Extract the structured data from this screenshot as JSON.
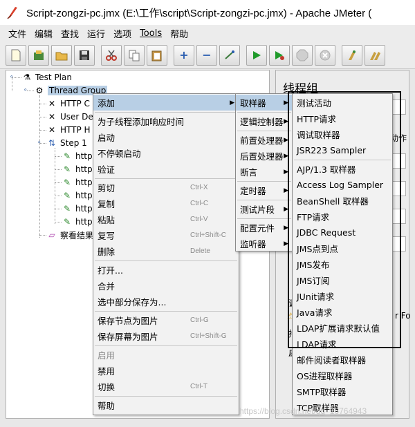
{
  "window": {
    "title": "Script-zongzi-pc.jmx (E:\\工作\\script\\Script-zongzi-pc.jmx) - Apache JMeter ("
  },
  "menubar": [
    "文件",
    "编辑",
    "查找",
    "运行",
    "选项",
    "Tools",
    "帮助"
  ],
  "toolbar": {
    "buttons": [
      "new-icon",
      "templates-icon",
      "open-icon",
      "save-icon",
      "cut-icon",
      "copy-icon",
      "paste-icon",
      "expand-icon",
      "collapse-icon",
      "toggle-icon",
      "start-icon",
      "start-no-pause-icon",
      "stop-icon",
      "shutdown-icon",
      "clear-icon",
      "clear-all-icon"
    ]
  },
  "tree": {
    "test_plan": "Test Plan",
    "thread_group": "Thread Group",
    "http_c": "HTTP C",
    "user_de": "User De",
    "http_h": "HTTP H",
    "step1": "Step 1",
    "http_children": [
      "http:",
      "http:",
      "http:",
      "http:",
      "http:",
      "http:"
    ],
    "view_results": "察看结果"
  },
  "right_panel": {
    "title": "线程组",
    "fragment1": "动作",
    "fragment2": "r Fo",
    "fragment3": "调",
    "fragment4": "持",
    "fragment5": "启"
  },
  "context_menu": {
    "add": "添加",
    "add_response_time": "为子线程添加响应时间",
    "start": "启动",
    "start_no_pause": "不停顿启动",
    "validate": "验证",
    "cut": "剪切",
    "cut_sc": "Ctrl-X",
    "copy": "复制",
    "copy_sc": "Ctrl-C",
    "paste": "粘贴",
    "paste_sc": "Ctrl-V",
    "duplicate": "复写",
    "duplicate_sc": "Ctrl+Shift-C",
    "delete": "删除",
    "delete_sc": "Delete",
    "open": "打开...",
    "merge": "合并",
    "save_selection": "选中部分保存为...",
    "save_node_image": "保存节点为图片",
    "save_node_image_sc": "Ctrl-G",
    "save_screen_image": "保存屏幕为图片",
    "save_screen_image_sc": "Ctrl+Shift-G",
    "enable": "启用",
    "disable": "禁用",
    "toggle": "切换",
    "toggle_sc": "Ctrl-T",
    "help": "帮助"
  },
  "add_submenu": {
    "sampler": "取样器",
    "logic_controller": "逻辑控制器",
    "pre_processor": "前置处理器",
    "post_processor": "后置处理器",
    "assertion": "断言",
    "timer": "定时器",
    "test_fragment": "测试片段",
    "config_element": "配置元件",
    "listener": "监听器"
  },
  "sampler_submenu": [
    "测试活动",
    "HTTP请求",
    "调试取样器",
    "JSR223 Sampler",
    "AJP/1.3 取样器",
    "Access Log Sampler",
    "BeanShell 取样器",
    "FTP请求",
    "JDBC Request",
    "JMS点到点",
    "JMS发布",
    "JMS订阅",
    "JUnit请求",
    "Java请求",
    "LDAP扩展请求默认值",
    "LDAP请求",
    "邮件阅读者取样器",
    "OS进程取样器",
    "SMTP取样器",
    "TCP取样器"
  ],
  "watermark": "https://blog.csdn.net/qq_16764943"
}
